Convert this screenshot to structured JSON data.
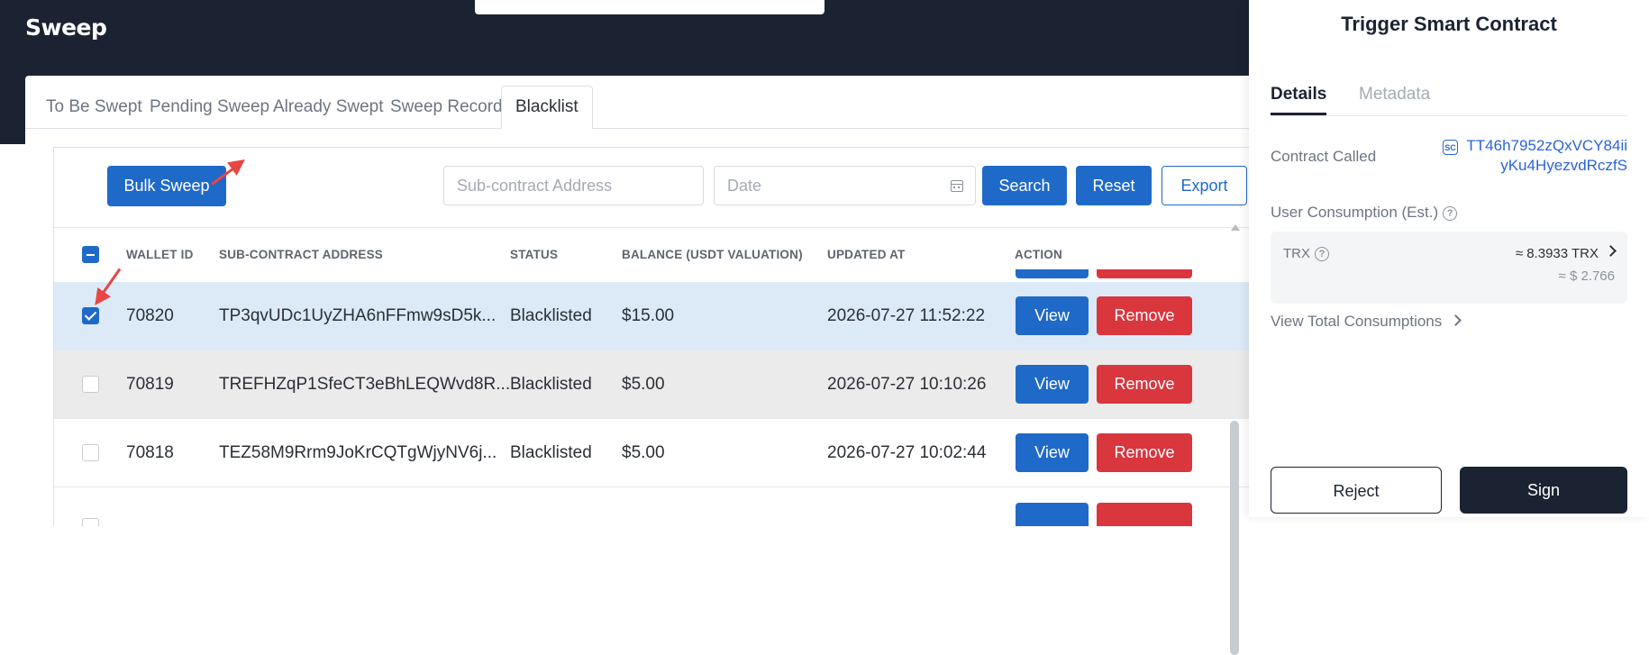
{
  "app": {
    "title": "Sweep"
  },
  "tabs": [
    {
      "label": "To Be Swept",
      "active": false
    },
    {
      "label": "Pending Sweep",
      "active": false
    },
    {
      "label": "Already Swept",
      "active": false
    },
    {
      "label": "Sweep Records",
      "active": false
    },
    {
      "label": "Blacklist",
      "active": true
    }
  ],
  "toolbar": {
    "bulk_sweep": "Bulk Sweep",
    "address_placeholder": "Sub-contract Address",
    "date_placeholder": "Date",
    "search": "Search",
    "reset": "Reset",
    "export": "Export"
  },
  "table": {
    "columns": [
      "WALLET ID",
      "SUB-CONTRACT ADDRESS",
      "STATUS",
      "BALANCE (USDT VALUATION)",
      "UPDATED AT",
      "ACTION"
    ],
    "rows": [
      {
        "wallet_id": "70820",
        "address": "TP3qvUDc1UyZHA6nFFmw9sD5k...",
        "status": "Blacklisted",
        "balance": "$15.00",
        "updated_at": "2026-07-27 11:52:22",
        "checked": true
      },
      {
        "wallet_id": "70819",
        "address": "TREFHZqP1SfeCT3eBhLEQWvd8R...",
        "status": "Blacklisted",
        "balance": "$5.00",
        "updated_at": "2026-07-27 10:10:26",
        "checked": false
      },
      {
        "wallet_id": "70818",
        "address": "TEZ58M9Rrm9JoKrCQTgWjyNV6j...",
        "status": "Blacklisted",
        "balance": "$5.00",
        "updated_at": "2026-07-27 10:02:44",
        "checked": false
      }
    ],
    "view_label": "View",
    "remove_label": "Remove"
  },
  "wallet": {
    "title": "Trigger Smart Contract",
    "tabs": [
      "Details",
      "Metadata"
    ],
    "contract_called_label": "Contract Called",
    "sc_badge": "SC",
    "contract_address_line1": "TT46h7952zQxVCY84ii",
    "contract_address_line2": "yKu4HyezvdRczfS",
    "user_consumption_label": "User Consumption (Est.)",
    "trx_label": "TRX",
    "trx_value": "≈ 8.3933 TRX",
    "usd_value": "≈ $ 2.766",
    "view_total": "View Total Consumptions",
    "reject": "Reject",
    "sign": "Sign"
  },
  "colors": {
    "header_bg": "#1b2332",
    "primary": "#1f6ac9",
    "danger": "#d9363e",
    "selected_row": "#dceaf8",
    "hover_row": "#ebebeb",
    "annotation_arrow": "#e94545"
  }
}
